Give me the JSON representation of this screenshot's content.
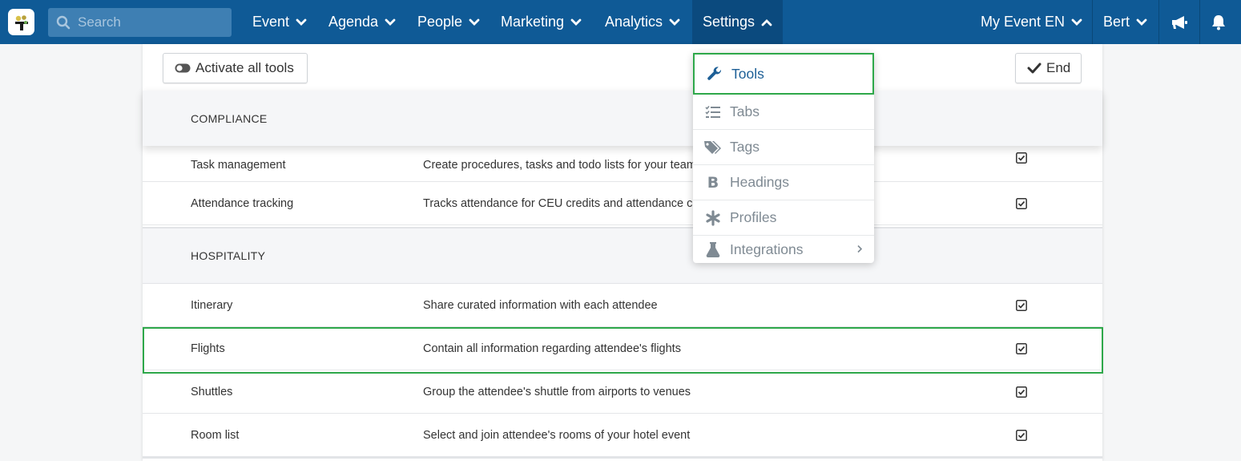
{
  "colors": {
    "nav": "#0f5a96",
    "navActive": "#0b4a7e",
    "highlight": "#2ea84a",
    "ddActive": "#1d5f96"
  },
  "search": {
    "placeholder": "Search",
    "icon": "search-icon"
  },
  "nav": {
    "items": [
      "Event",
      "Agenda",
      "People",
      "Marketing",
      "Analytics",
      "Settings"
    ],
    "right": [
      "My Event EN",
      "Bert"
    ],
    "icons": [
      "megaphone-icon",
      "bell-icon"
    ]
  },
  "toolbar": {
    "activate": "Activate all tools",
    "end": "End"
  },
  "sections": {
    "compliance": {
      "title": "COMPLIANCE",
      "rows": [
        {
          "name": "Task management",
          "desc": "Create procedures, tasks and todo lists for your team",
          "checked": true
        },
        {
          "name": "Attendance tracking",
          "desc": "Tracks attendance for CEU credits and attendance certificates",
          "checked": true
        }
      ]
    },
    "hospitality": {
      "title": "HOSPITALITY",
      "rows": [
        {
          "name": "Itinerary",
          "desc": "Share curated information with each attendee",
          "checked": true
        },
        {
          "name": "Flights",
          "desc": "Contain all information regarding attendee's flights",
          "checked": true
        },
        {
          "name": "Shuttles",
          "desc": "Group the attendee's shuttle from airports to venues",
          "checked": true
        },
        {
          "name": "Room list",
          "desc": "Select and join attendee's rooms of your hotel event",
          "checked": true
        }
      ]
    }
  },
  "dropdown": {
    "items": [
      {
        "label": "Tools",
        "icon": "wrench-icon"
      },
      {
        "label": "Tabs",
        "icon": "list-check-icon"
      },
      {
        "label": "Tags",
        "icon": "tags-icon"
      },
      {
        "label": "Headings",
        "icon": "bold-icon"
      },
      {
        "label": "Profiles",
        "icon": "asterisk-icon"
      },
      {
        "label": "Integrations",
        "icon": "flask-icon"
      }
    ]
  }
}
